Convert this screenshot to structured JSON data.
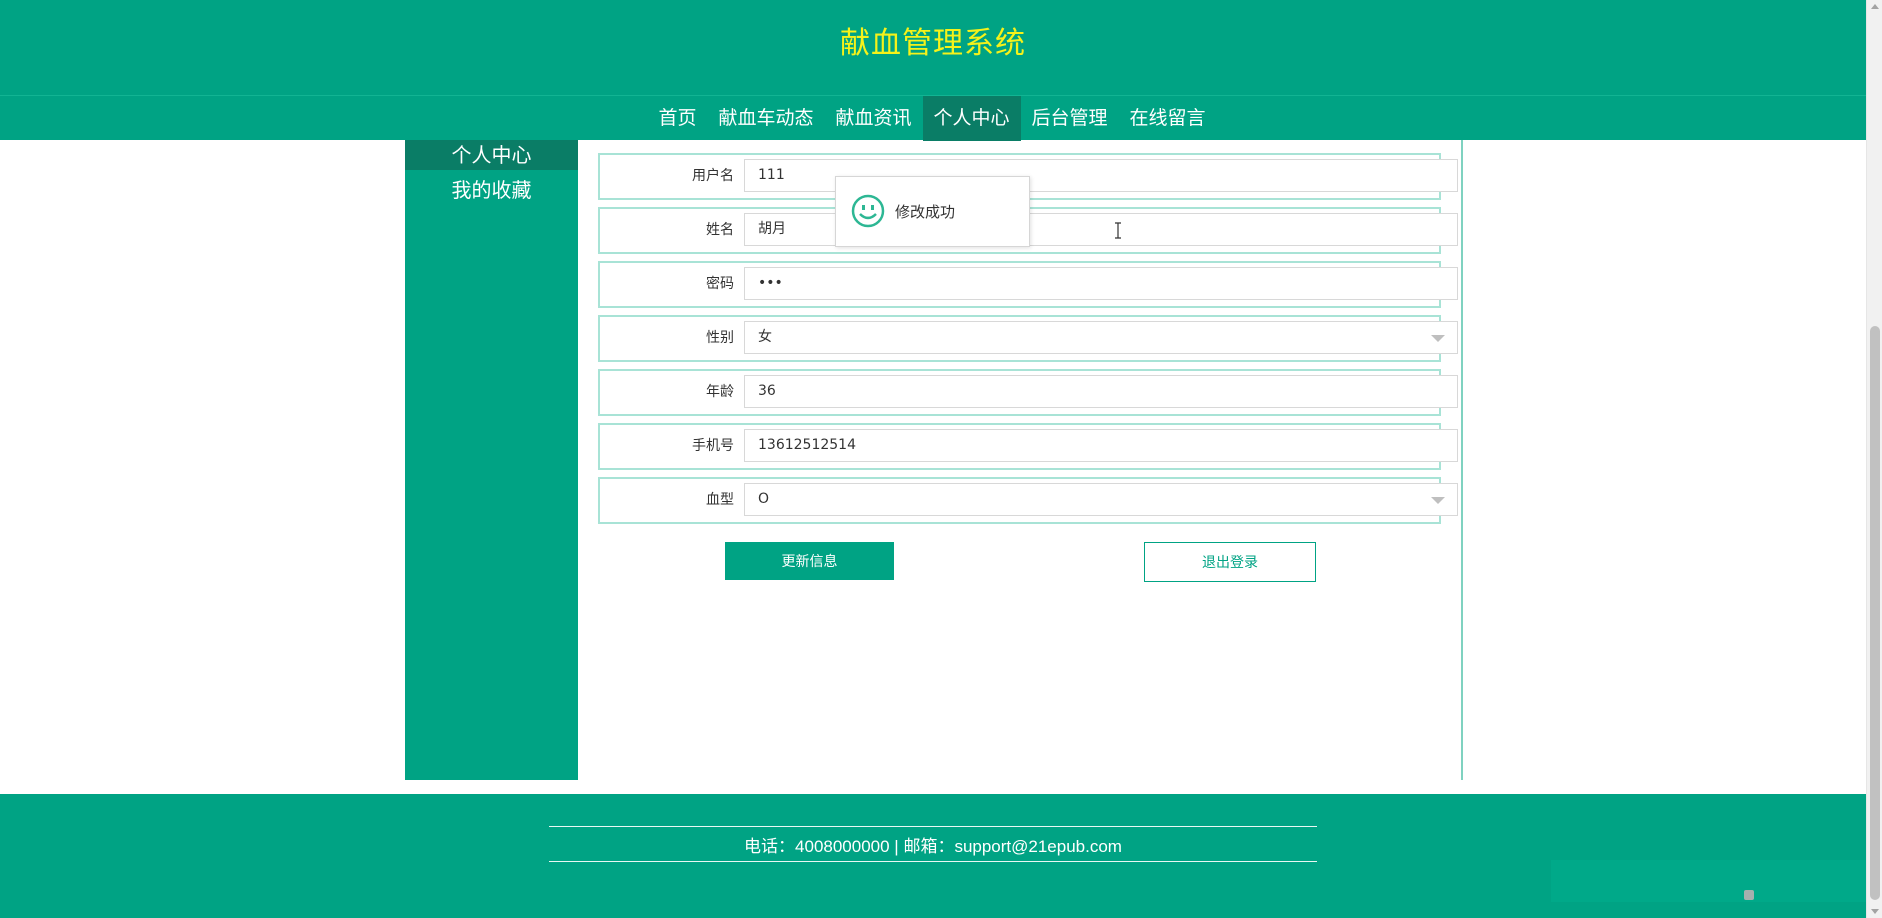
{
  "header": {
    "title": "献血管理系统"
  },
  "nav": {
    "items": [
      {
        "label": "首页"
      },
      {
        "label": "献血车动态"
      },
      {
        "label": "献血资讯"
      },
      {
        "label": "个人中心"
      },
      {
        "label": "后台管理"
      },
      {
        "label": "在线留言"
      }
    ],
    "active": "个人中心"
  },
  "sidebar": {
    "items": [
      {
        "label": "个人中心"
      },
      {
        "label": "我的收藏"
      }
    ]
  },
  "form": {
    "fields": [
      {
        "label": "用户名",
        "value": "111"
      },
      {
        "label": "姓名",
        "value": "胡月"
      },
      {
        "label": "密码",
        "value": "•••"
      },
      {
        "label": "性别",
        "value": "女"
      },
      {
        "label": "年龄",
        "value": "36"
      },
      {
        "label": "手机号",
        "value": "13612512514"
      },
      {
        "label": "血型",
        "value": "O"
      }
    ],
    "update_button": "更新信息",
    "logout_button": "退出登录"
  },
  "toast": {
    "message": "修改成功",
    "icon": "smile-icon"
  },
  "footer": {
    "contact": "电话：4008000000 | 邮箱：support@21epub.com"
  },
  "colors": {
    "primary": "#00a384",
    "active_nav": "#0a7d66",
    "title": "#f5f21a"
  }
}
